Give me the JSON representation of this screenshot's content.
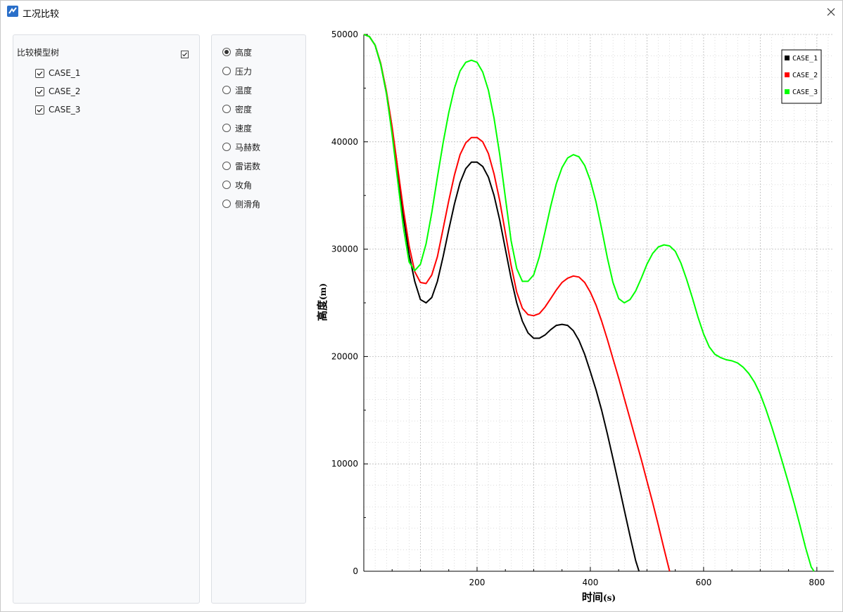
{
  "window": {
    "title": "工况比较"
  },
  "tree": {
    "root_label": "比较模型树",
    "root_checked": true,
    "items": [
      {
        "label": "CASE_1",
        "checked": true
      },
      {
        "label": "CASE_2",
        "checked": true
      },
      {
        "label": "CASE_3",
        "checked": true
      }
    ]
  },
  "radio": {
    "selected": "高度",
    "options": [
      "高度",
      "压力",
      "温度",
      "密度",
      "速度",
      "马赫数",
      "雷诺数",
      "攻角",
      "侧滑角"
    ]
  },
  "colors": {
    "case1": "#000000",
    "case2": "#ff0000",
    "case3": "#00ff00",
    "grid": "#b8b8b8",
    "panel_bg": "#f8f9fb"
  },
  "icons": [
    "app-logo-icon",
    "close-icon",
    "checkbox-checked-icon",
    "radio-selected-icon",
    "radio-unselected-icon"
  ],
  "chart_data": {
    "type": "line",
    "title": "",
    "xlabel_main": "时间",
    "xlabel_unit": "(s)",
    "ylabel_main": "高度",
    "ylabel_unit": "(m)",
    "xlim": [
      0,
      830
    ],
    "ylim": [
      0,
      50000
    ],
    "xticks": [
      200,
      400,
      600,
      800
    ],
    "yticks": [
      0,
      10000,
      20000,
      30000,
      40000,
      50000
    ],
    "grid": true,
    "legend_position": "top-right",
    "series": [
      {
        "name": "CASE_1",
        "color": "#000000",
        "points": [
          [
            0,
            50000
          ],
          [
            10,
            49800
          ],
          [
            20,
            49000
          ],
          [
            30,
            47200
          ],
          [
            40,
            44500
          ],
          [
            50,
            41000
          ],
          [
            60,
            37000
          ],
          [
            70,
            33000
          ],
          [
            80,
            29500
          ],
          [
            90,
            27000
          ],
          [
            100,
            25300
          ],
          [
            110,
            25000
          ],
          [
            120,
            25500
          ],
          [
            130,
            27000
          ],
          [
            140,
            29300
          ],
          [
            150,
            31800
          ],
          [
            160,
            34200
          ],
          [
            170,
            36200
          ],
          [
            180,
            37500
          ],
          [
            190,
            38100
          ],
          [
            200,
            38100
          ],
          [
            210,
            37700
          ],
          [
            220,
            36700
          ],
          [
            230,
            35000
          ],
          [
            240,
            32700
          ],
          [
            250,
            30000
          ],
          [
            260,
            27300
          ],
          [
            270,
            25000
          ],
          [
            280,
            23300
          ],
          [
            290,
            22200
          ],
          [
            300,
            21700
          ],
          [
            310,
            21700
          ],
          [
            320,
            22000
          ],
          [
            330,
            22500
          ],
          [
            340,
            22900
          ],
          [
            350,
            23000
          ],
          [
            360,
            22900
          ],
          [
            370,
            22400
          ],
          [
            380,
            21500
          ],
          [
            390,
            20200
          ],
          [
            400,
            18600
          ],
          [
            410,
            16900
          ],
          [
            420,
            15000
          ],
          [
            430,
            12800
          ],
          [
            440,
            10500
          ],
          [
            450,
            8100
          ],
          [
            460,
            5700
          ],
          [
            470,
            3300
          ],
          [
            480,
            1000
          ],
          [
            486,
            0
          ]
        ]
      },
      {
        "name": "CASE_2",
        "color": "#ff0000",
        "points": [
          [
            0,
            50000
          ],
          [
            10,
            49800
          ],
          [
            20,
            49000
          ],
          [
            30,
            47300
          ],
          [
            40,
            44700
          ],
          [
            50,
            41400
          ],
          [
            60,
            37500
          ],
          [
            70,
            33700
          ],
          [
            80,
            30300
          ],
          [
            90,
            27900
          ],
          [
            100,
            26900
          ],
          [
            110,
            26800
          ],
          [
            120,
            27600
          ],
          [
            130,
            29300
          ],
          [
            140,
            31900
          ],
          [
            150,
            34500
          ],
          [
            160,
            36900
          ],
          [
            170,
            38800
          ],
          [
            180,
            39900
          ],
          [
            190,
            40400
          ],
          [
            200,
            40400
          ],
          [
            210,
            40000
          ],
          [
            220,
            38900
          ],
          [
            230,
            37000
          ],
          [
            240,
            34500
          ],
          [
            250,
            31500
          ],
          [
            260,
            28500
          ],
          [
            270,
            26000
          ],
          [
            280,
            24500
          ],
          [
            290,
            23900
          ],
          [
            300,
            23800
          ],
          [
            310,
            24000
          ],
          [
            320,
            24600
          ],
          [
            330,
            25400
          ],
          [
            340,
            26200
          ],
          [
            350,
            26900
          ],
          [
            360,
            27300
          ],
          [
            370,
            27500
          ],
          [
            380,
            27400
          ],
          [
            390,
            26900
          ],
          [
            400,
            26000
          ],
          [
            410,
            24800
          ],
          [
            420,
            23300
          ],
          [
            430,
            21600
          ],
          [
            440,
            19800
          ],
          [
            450,
            18000
          ],
          [
            460,
            16100
          ],
          [
            470,
            14200
          ],
          [
            480,
            12300
          ],
          [
            490,
            10400
          ],
          [
            500,
            8400
          ],
          [
            510,
            6400
          ],
          [
            520,
            4300
          ],
          [
            530,
            2100
          ],
          [
            540,
            0
          ]
        ]
      },
      {
        "name": "CASE_3",
        "color": "#00ff00",
        "points": [
          [
            0,
            50000
          ],
          [
            10,
            49800
          ],
          [
            20,
            49000
          ],
          [
            30,
            47200
          ],
          [
            40,
            44500
          ],
          [
            50,
            40700
          ],
          [
            60,
            36300
          ],
          [
            70,
            32000
          ],
          [
            80,
            28800
          ],
          [
            90,
            28000
          ],
          [
            100,
            28600
          ],
          [
            110,
            30500
          ],
          [
            120,
            33400
          ],
          [
            130,
            36700
          ],
          [
            140,
            39900
          ],
          [
            150,
            42700
          ],
          [
            160,
            45000
          ],
          [
            170,
            46600
          ],
          [
            180,
            47400
          ],
          [
            190,
            47600
          ],
          [
            200,
            47400
          ],
          [
            210,
            46500
          ],
          [
            220,
            44800
          ],
          [
            230,
            42200
          ],
          [
            240,
            38800
          ],
          [
            250,
            34800
          ],
          [
            260,
            30800
          ],
          [
            270,
            28200
          ],
          [
            280,
            27000
          ],
          [
            290,
            27000
          ],
          [
            300,
            27600
          ],
          [
            310,
            29300
          ],
          [
            320,
            31600
          ],
          [
            330,
            34000
          ],
          [
            340,
            36100
          ],
          [
            350,
            37600
          ],
          [
            360,
            38500
          ],
          [
            370,
            38800
          ],
          [
            380,
            38600
          ],
          [
            390,
            37800
          ],
          [
            400,
            36400
          ],
          [
            410,
            34400
          ],
          [
            420,
            31900
          ],
          [
            430,
            29200
          ],
          [
            440,
            26900
          ],
          [
            450,
            25400
          ],
          [
            460,
            25000
          ],
          [
            470,
            25300
          ],
          [
            480,
            26100
          ],
          [
            490,
            27300
          ],
          [
            500,
            28600
          ],
          [
            510,
            29600
          ],
          [
            520,
            30200
          ],
          [
            530,
            30400
          ],
          [
            540,
            30300
          ],
          [
            550,
            29800
          ],
          [
            560,
            28700
          ],
          [
            570,
            27200
          ],
          [
            580,
            25500
          ],
          [
            590,
            23700
          ],
          [
            600,
            22100
          ],
          [
            610,
            20900
          ],
          [
            620,
            20200
          ],
          [
            630,
            19900
          ],
          [
            640,
            19700
          ],
          [
            650,
            19600
          ],
          [
            660,
            19400
          ],
          [
            670,
            19000
          ],
          [
            680,
            18400
          ],
          [
            690,
            17600
          ],
          [
            700,
            16500
          ],
          [
            710,
            15100
          ],
          [
            720,
            13500
          ],
          [
            730,
            11800
          ],
          [
            740,
            10000
          ],
          [
            750,
            8200
          ],
          [
            760,
            6300
          ],
          [
            770,
            4300
          ],
          [
            780,
            2200
          ],
          [
            790,
            400
          ],
          [
            795,
            0
          ]
        ]
      }
    ]
  }
}
